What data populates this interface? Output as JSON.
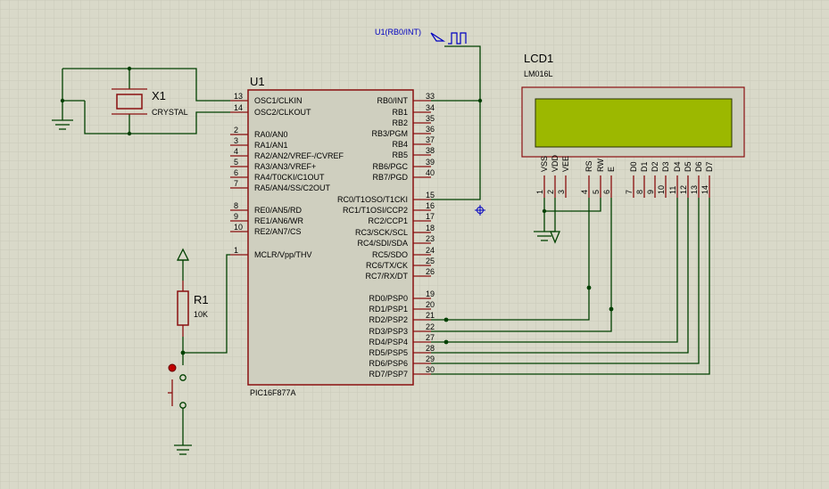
{
  "mcu": {
    "ref": "U1",
    "part": "PIC16F877A",
    "left_pins": [
      {
        "num": "13",
        "label": "OSC1/CLKIN"
      },
      {
        "num": "14",
        "label": "OSC2/CLKOUT"
      },
      {
        "num": "2",
        "label": "RA0/AN0"
      },
      {
        "num": "3",
        "label": "RA1/AN1"
      },
      {
        "num": "4",
        "label": "RA2/AN2/VREF-/CVREF"
      },
      {
        "num": "5",
        "label": "RA3/AN3/VREF+"
      },
      {
        "num": "6",
        "label": "RA4/T0CKI/C1OUT"
      },
      {
        "num": "7",
        "label": "RA5/AN4/SS/C2OUT"
      },
      {
        "num": "8",
        "label": "RE0/AN5/RD"
      },
      {
        "num": "9",
        "label": "RE1/AN6/WR"
      },
      {
        "num": "10",
        "label": "RE2/AN7/CS"
      },
      {
        "num": "1",
        "label": "MCLR/Vpp/THV"
      }
    ],
    "right_pins": [
      {
        "num": "33",
        "label": "RB0/INT"
      },
      {
        "num": "34",
        "label": "RB1"
      },
      {
        "num": "35",
        "label": "RB2"
      },
      {
        "num": "36",
        "label": "RB3/PGM"
      },
      {
        "num": "37",
        "label": "RB4"
      },
      {
        "num": "38",
        "label": "RB5"
      },
      {
        "num": "39",
        "label": "RB6/PGC"
      },
      {
        "num": "40",
        "label": "RB7/PGD"
      },
      {
        "num": "15",
        "label": "RC0/T1OSO/T1CKI"
      },
      {
        "num": "16",
        "label": "RC1/T1OSI/CCP2"
      },
      {
        "num": "17",
        "label": "RC2/CCP1"
      },
      {
        "num": "18",
        "label": "RC3/SCK/SCL"
      },
      {
        "num": "23",
        "label": "RC4/SDI/SDA"
      },
      {
        "num": "24",
        "label": "RC5/SDO"
      },
      {
        "num": "25",
        "label": "RC6/TX/CK"
      },
      {
        "num": "26",
        "label": "RC7/RX/DT"
      },
      {
        "num": "19",
        "label": "RD0/PSP0"
      },
      {
        "num": "20",
        "label": "RD1/PSP1"
      },
      {
        "num": "21",
        "label": "RD2/PSP2"
      },
      {
        "num": "22",
        "label": "RD3/PSP3"
      },
      {
        "num": "27",
        "label": "RD4/PSP4"
      },
      {
        "num": "28",
        "label": "RD5/PSP5"
      },
      {
        "num": "29",
        "label": "RD6/PSP6"
      },
      {
        "num": "30",
        "label": "RD7/PSP7"
      }
    ]
  },
  "lcd": {
    "ref": "LCD1",
    "part": "LM016L",
    "pins": [
      {
        "label": "VSS",
        "num": "1"
      },
      {
        "label": "VDD",
        "num": "2"
      },
      {
        "label": "VEE",
        "num": "3"
      },
      {
        "label": "RS",
        "num": "4"
      },
      {
        "label": "RW",
        "num": "5"
      },
      {
        "label": "E",
        "num": "6"
      },
      {
        "label": "D0",
        "num": "7"
      },
      {
        "label": "D1",
        "num": "8"
      },
      {
        "label": "D2",
        "num": "9"
      },
      {
        "label": "D3",
        "num": "10"
      },
      {
        "label": "D4",
        "num": "11"
      },
      {
        "label": "D5",
        "num": "12"
      },
      {
        "label": "D6",
        "num": "13"
      },
      {
        "label": "D7",
        "num": "14"
      }
    ],
    "screen_color": "#9cb800"
  },
  "crystal": {
    "ref": "X1",
    "part": "CRYSTAL"
  },
  "resistor": {
    "ref": "R1",
    "value": "10K"
  },
  "probe": {
    "label": "U1(RB0/INT)"
  },
  "colors": {
    "background": "#d9d9c9",
    "grid": "#c9c9b9",
    "wire": "#004000",
    "pin": "#8b1010",
    "body": "#cfcfbf",
    "probe_text": "#0000c0"
  }
}
